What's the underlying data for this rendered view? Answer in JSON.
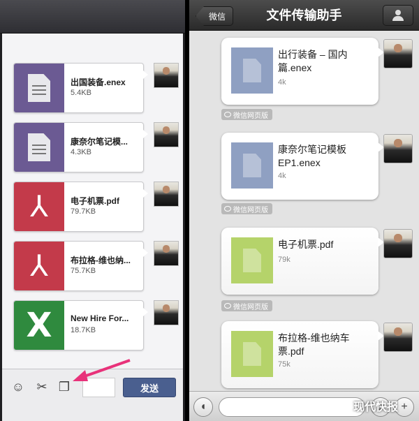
{
  "left_panel": {
    "messages": [
      {
        "name": "出国装备.enex",
        "size": "5.4KB",
        "type": "enex"
      },
      {
        "name": "康奈尔笔记模...",
        "size": "4.3KB",
        "type": "enex"
      },
      {
        "name": "电子机票.pdf",
        "size": "79.7KB",
        "type": "pdf"
      },
      {
        "name": "布拉格-维也纳...",
        "size": "75.7KB",
        "type": "pdf"
      },
      {
        "name": "New Hire For...",
        "size": "18.7KB",
        "type": "xls"
      }
    ],
    "toolbar": {
      "emoji_icon": "smiley-icon",
      "screenshot_icon": "scissors-icon",
      "file_icon": "file-icon",
      "send_label": "发送"
    },
    "accent_color": "#4a5f8f"
  },
  "right_panel": {
    "nav": {
      "back_label": "微信",
      "title": "文件传输助手",
      "profile_icon": "person-icon"
    },
    "messages": [
      {
        "name": "出行装备 – 国内篇.enex",
        "size": "4k",
        "thumb": "blue",
        "source": "微信网页版"
      },
      {
        "name": "康奈尔笔记模板EP1.enex",
        "size": "4k",
        "thumb": "blue",
        "source": "微信网页版"
      },
      {
        "name": "电子机票.pdf",
        "size": "79k",
        "thumb": "lime",
        "source": "微信网页版"
      },
      {
        "name": "布拉格-维也纳车票.pdf",
        "size": "75k",
        "thumb": "lime",
        "source": ""
      }
    ],
    "bottom": {
      "voice_icon": "voice-icon",
      "emoji_icon": "smiley-icon",
      "plus_icon": "plus-icon"
    },
    "watermark": "现代快报"
  }
}
